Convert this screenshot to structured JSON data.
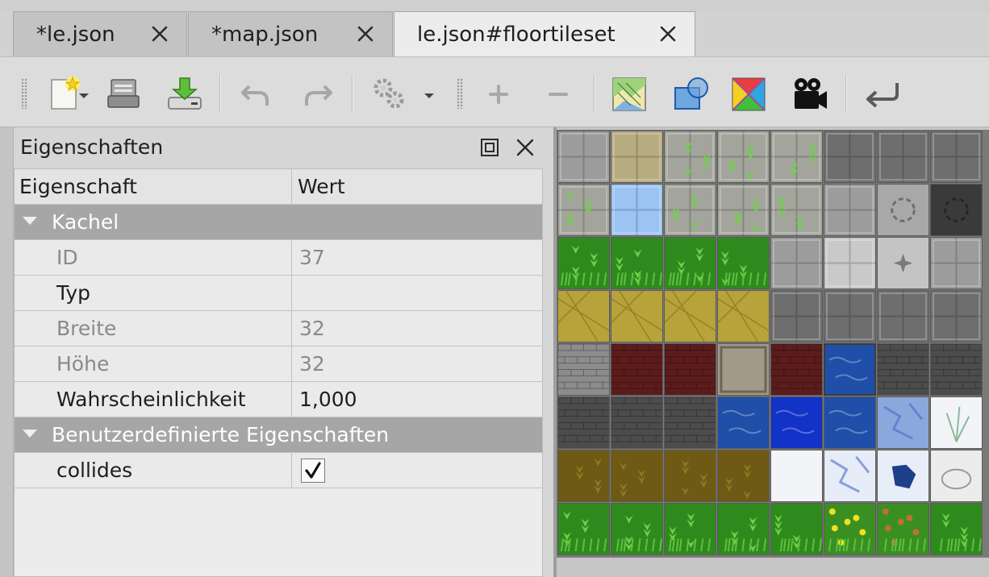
{
  "tabs": [
    {
      "label": "*le.json",
      "active": false
    },
    {
      "label": "*map.json",
      "active": false
    },
    {
      "label": "le.json#floortileset",
      "active": true
    }
  ],
  "toolbar": {
    "buttons": [
      {
        "name": "new-file-button",
        "icon": "new-file-icon",
        "enabled": true
      },
      {
        "name": "open-file-button",
        "icon": "open-folder-icon",
        "enabled": true
      },
      {
        "name": "save-button",
        "icon": "save-download-icon",
        "enabled": true
      },
      {
        "name": "undo-button",
        "icon": "undo-icon",
        "enabled": false
      },
      {
        "name": "redo-button",
        "icon": "redo-icon",
        "enabled": false
      },
      {
        "name": "settings-button",
        "icon": "gears-icon",
        "enabled": false
      },
      {
        "name": "add-button",
        "icon": "plus-icon",
        "enabled": false
      },
      {
        "name": "remove-button",
        "icon": "minus-icon",
        "enabled": false
      },
      {
        "name": "terrain-button",
        "icon": "terrain-map-icon",
        "enabled": true
      },
      {
        "name": "collision-button",
        "icon": "shapes-icon",
        "enabled": true
      },
      {
        "name": "wang-color-button",
        "icon": "color-quadrants-icon",
        "enabled": true
      },
      {
        "name": "animation-button",
        "icon": "movie-camera-icon",
        "enabled": true
      },
      {
        "name": "return-button",
        "icon": "return-arrow-icon",
        "enabled": true
      }
    ]
  },
  "properties_panel": {
    "title": "Eigenschaften",
    "columns": {
      "property": "Eigenschaft",
      "value": "Wert"
    },
    "groups": [
      {
        "label": "Kachel",
        "rows": [
          {
            "name": "ID",
            "value": "37",
            "readonly": true
          },
          {
            "name": "Typ",
            "value": "",
            "readonly": false
          },
          {
            "name": "Breite",
            "value": "32",
            "readonly": true
          },
          {
            "name": "Höhe",
            "value": "32",
            "readonly": true
          },
          {
            "name": "Wahrscheinlichkeit",
            "value": "1,000",
            "readonly": false
          }
        ]
      },
      {
        "label": "Benutzerdefinierte Eigenschaften",
        "rows": [
          {
            "name": "collides",
            "checked": true
          }
        ]
      }
    ]
  },
  "tileset": {
    "columns": 8,
    "rows": 8,
    "selected_index": 37,
    "colors": {
      "grass": "#2f8a1e",
      "stone": "#9a9a9a",
      "sand": "#b8a23a",
      "water": "#1f4fa8",
      "snow": "#f2f4f8",
      "dirt": "#6e5a14"
    }
  }
}
